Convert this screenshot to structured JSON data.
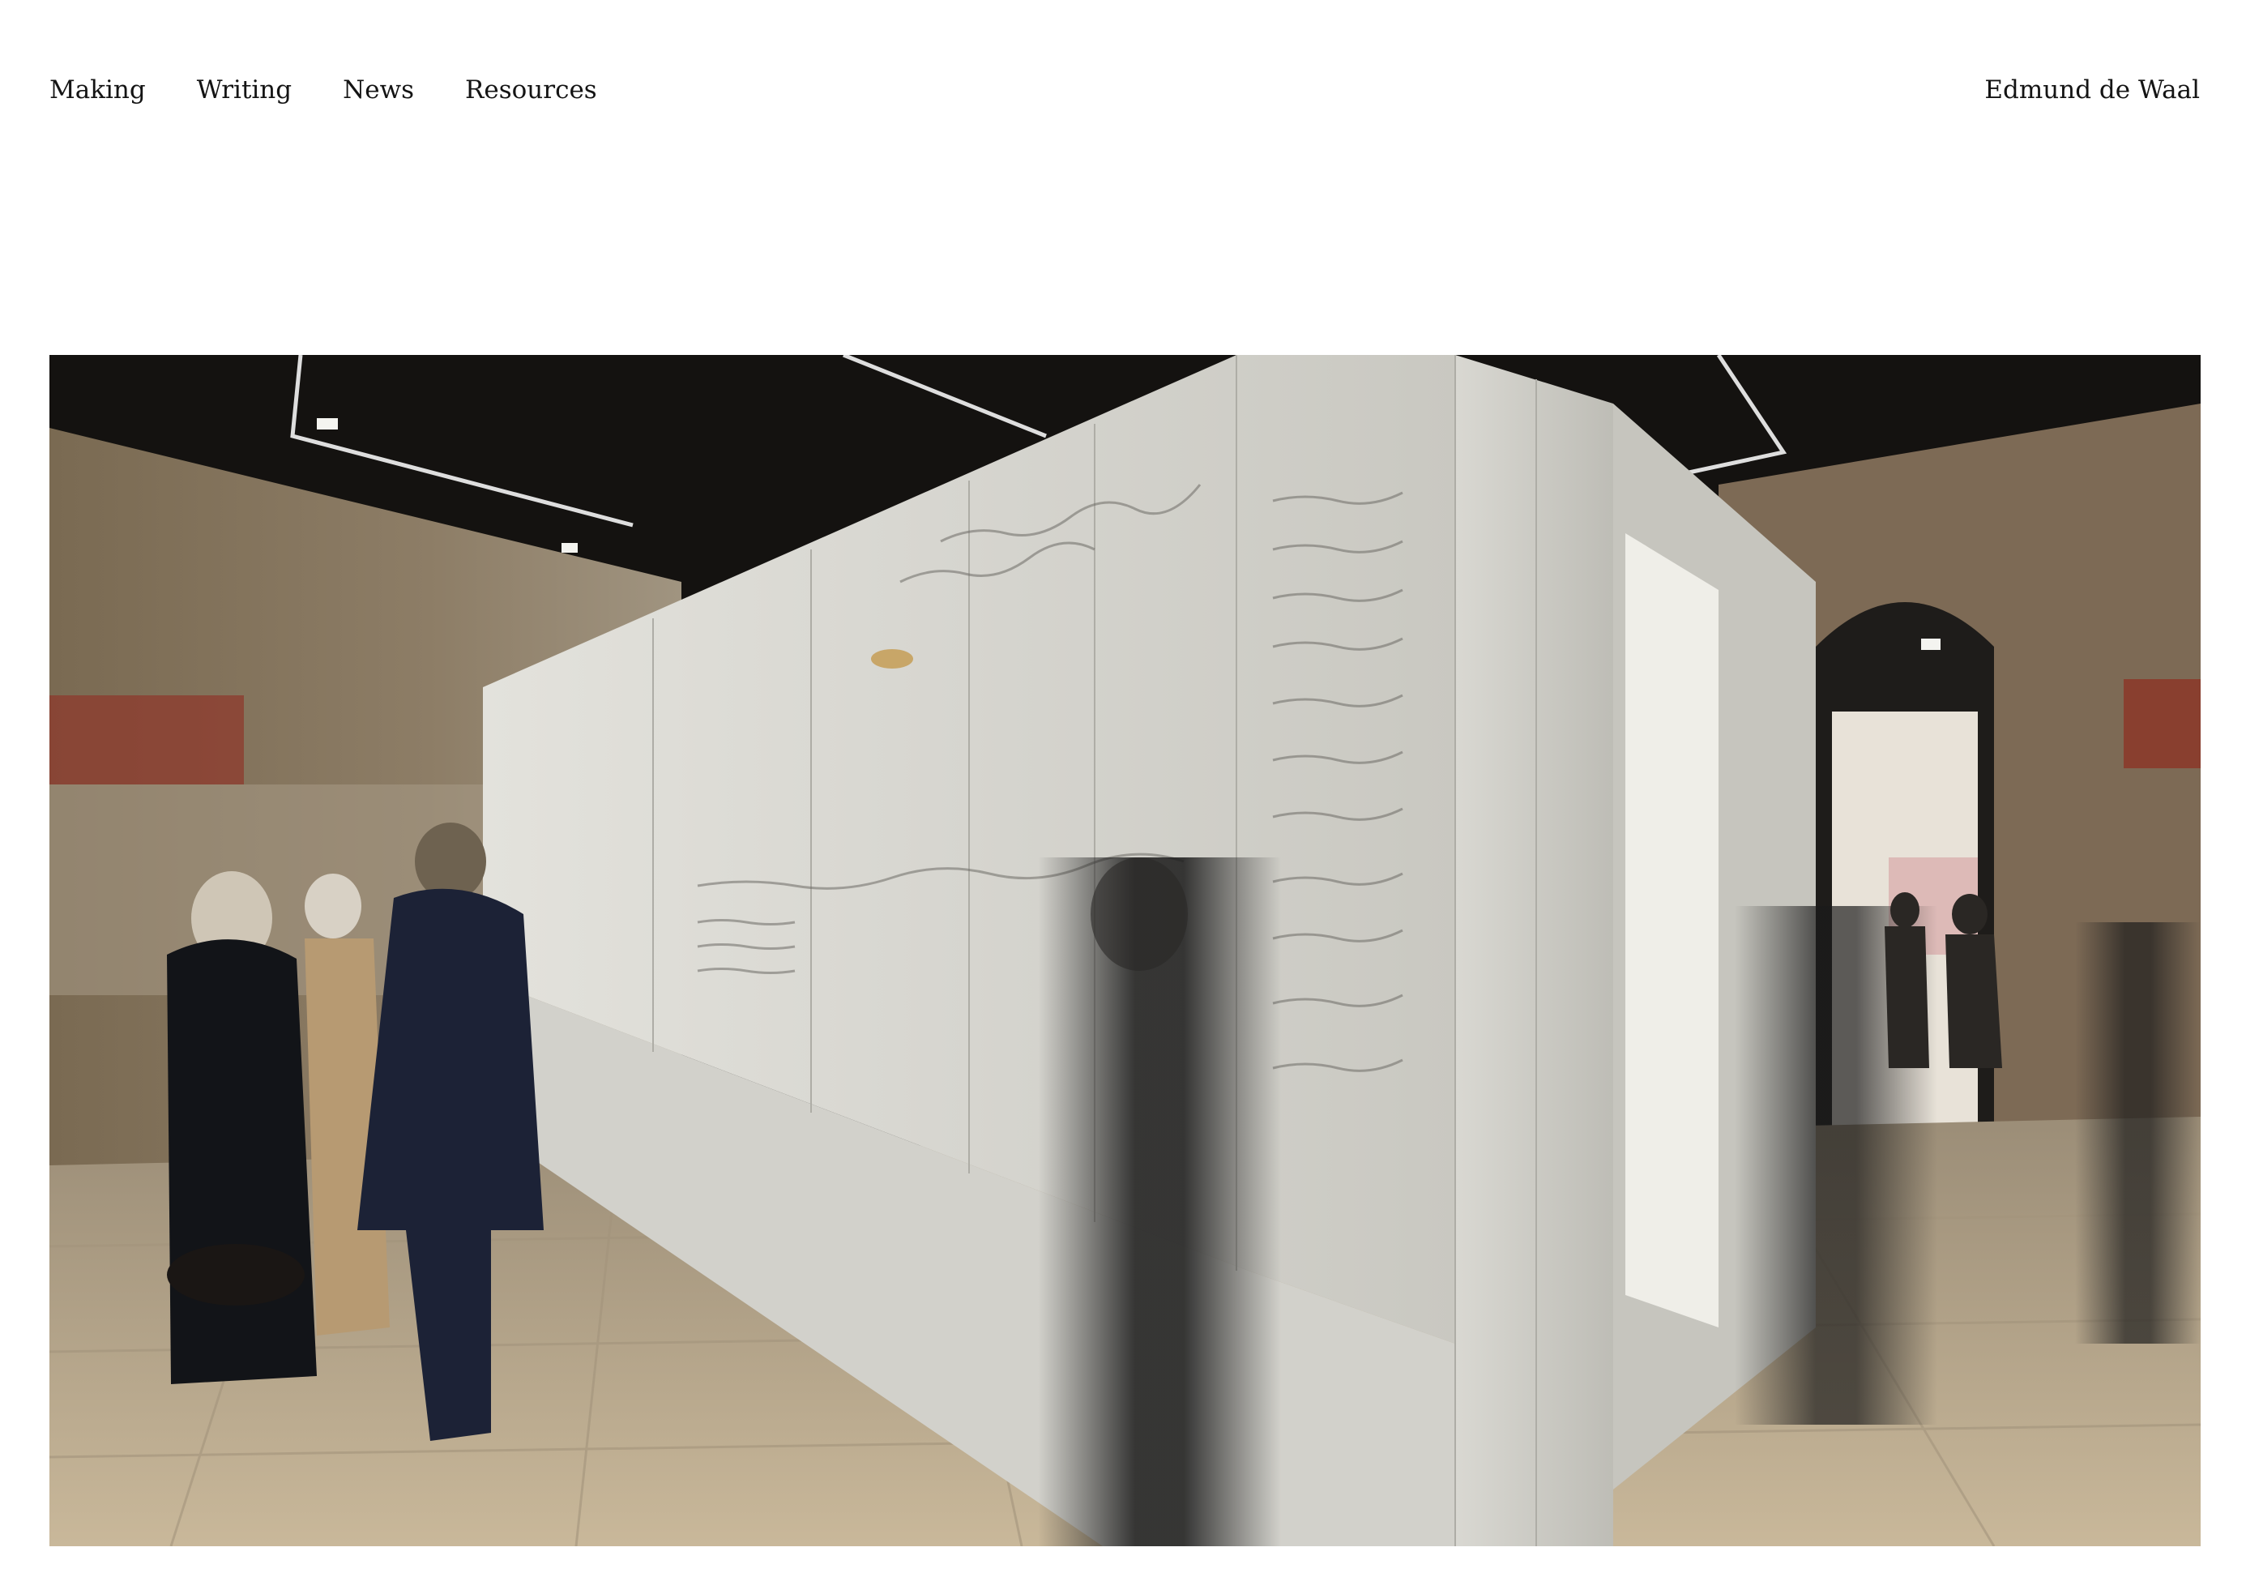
{
  "nav": {
    "items": [
      {
        "label": "Making"
      },
      {
        "label": "Writing"
      },
      {
        "label": "News"
      },
      {
        "label": "Resources"
      }
    ]
  },
  "brand": {
    "name": "Edmund de Waal"
  },
  "hero": {
    "kind": "photograph",
    "colors": {
      "ceiling": "#141210",
      "wall_plaster": "#8a7a62",
      "installation": "#dcdbd6",
      "floor": "#b8a88e"
    }
  }
}
